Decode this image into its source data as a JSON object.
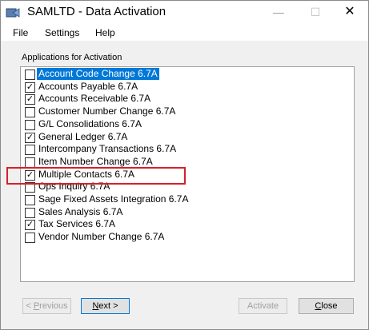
{
  "window": {
    "title": "SAMLTD - Data Activation"
  },
  "controls": {
    "minimize": "—",
    "maximize": "☐",
    "close": "✕"
  },
  "menu": {
    "items": [
      "File",
      "Settings",
      "Help"
    ]
  },
  "group": {
    "label": "Applications for Activation"
  },
  "applications": [
    {
      "label": "Account Code Change 6.7A",
      "checked": false,
      "selected": true
    },
    {
      "label": "Accounts Payable 6.7A",
      "checked": true
    },
    {
      "label": "Accounts Receivable 6.7A",
      "checked": true
    },
    {
      "label": "Customer Number Change 6.7A",
      "checked": false
    },
    {
      "label": "G/L Consolidations 6.7A",
      "checked": false
    },
    {
      "label": "General Ledger 6.7A",
      "checked": true
    },
    {
      "label": "Intercompany Transactions 6.7A",
      "checked": false
    },
    {
      "label": "Item Number Change 6.7A",
      "checked": false
    },
    {
      "label": "Multiple Contacts 6.7A",
      "checked": true,
      "highlighted": true
    },
    {
      "label": "Ops Inquiry 6.7A",
      "checked": false
    },
    {
      "label": "Sage Fixed Assets Integration 6.7A",
      "checked": false
    },
    {
      "label": "Sales Analysis 6.7A",
      "checked": false
    },
    {
      "label": "Tax Services 6.7A",
      "checked": true
    },
    {
      "label": "Vendor Number Change 6.7A",
      "checked": false
    }
  ],
  "buttons": {
    "previous": {
      "mnemonic": "P",
      "rest": "revious",
      "prefix": "< ",
      "enabled": false
    },
    "next": {
      "mnemonic": "N",
      "rest": "ext >",
      "enabled": true
    },
    "activate": {
      "label": "Activate",
      "enabled": false
    },
    "close": {
      "mnemonic": "C",
      "rest": "lose",
      "enabled": true
    }
  },
  "colors": {
    "selection": "#0078d7",
    "highlight_border": "#d6202a"
  }
}
